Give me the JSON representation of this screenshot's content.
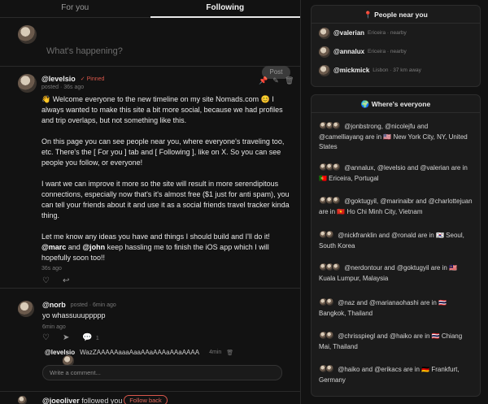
{
  "tabs": [
    {
      "label": "For you"
    },
    {
      "label": "Following"
    }
  ],
  "composer": {
    "placeholder": "What's happening?",
    "post_label": "Post"
  },
  "pinned_post": {
    "username": "@levelsio",
    "pinned_label": "✓ Pinned",
    "posted": "posted · 36s ago",
    "p1": "👋 Welcome everyone to the new timeline on my site Nomads.com 😊 I always wanted to make this site a bit more social, because we had profiles and trip overlaps, but not something like this.",
    "p2": "On this page you can see people near you, where everyone's traveling too, etc. There's the [ For you ] tab and [ Following ], like on X. So you can see people you follow, or everyone!",
    "p3": "I want we can improve it more so the site will result in more serendipitous connections, especially now that's it's almost free ($1 just for anti spam), you can tell your friends about it and use it as a social friends travel tracker kinda thing.",
    "p4_a": "Let me know any ideas you have and things I should build and I'll do it!",
    "p4_m1": "@marc",
    "p4_and": " and ",
    "p4_m2": "@john",
    "p4_b": " keep hassling me to finish the iOS app which I will hopefully soon too!!",
    "time": "36s ago"
  },
  "post2": {
    "username": "@norb",
    "posted": "posted · 6min ago",
    "text": "yo whassuuuppppp",
    "time": "6min ago",
    "comment_count": "1",
    "reply_user": "@levelsio",
    "reply_text": "WazZAAAAAaaaAaaAAaAAAaAAaAAAA",
    "reply_time": "4min",
    "comment_placeholder": "Write a comment..."
  },
  "follow": {
    "text_user": "@joeoliver",
    "text_rest": " followed you",
    "button": "Follow back"
  },
  "near": {
    "title": "📍 People near you",
    "people": [
      {
        "name": "@valerian",
        "loc": "Ericeira · nearby"
      },
      {
        "name": "@annalux",
        "loc": "Ericeira · nearby"
      },
      {
        "name": "@mickmick",
        "loc": "Lisbon · 37 km away"
      }
    ]
  },
  "where": {
    "title": "🌍 Where's everyone",
    "groups": [
      {
        "text": "@jonbstrong, @nicolejfu and @camelliayang are in 🇺🇸 New York City, NY, United States"
      },
      {
        "text": "@annalux, @levelsio and @valerian are in 🇵🇹 Ericeira, Portugal"
      },
      {
        "text": "@goktugyil, @marinaibr and @charlottejuan are in 🇻🇳 Ho Chi Minh City, Vietnam"
      },
      {
        "text": "@nickfranklin and @ronald are in 🇰🇷 Seoul, South Korea"
      },
      {
        "text": "@nerdontour and @goktugyil are in 🇲🇾 Kuala Lumpur, Malaysia"
      },
      {
        "text": "@naz and @marianaohashi are in 🇹🇭 Bangkok, Thailand"
      },
      {
        "text": "@chrisspiegl and @haiko are in 🇹🇭 Chiang Mai, Thailand"
      },
      {
        "text": "@haiko and @erikacs are in 🇩🇪 Frankfurt, Germany"
      }
    ]
  }
}
